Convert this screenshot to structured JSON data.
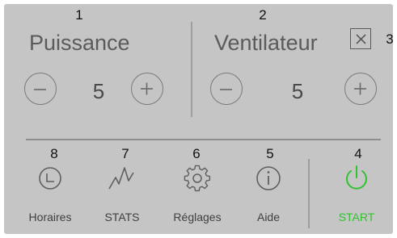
{
  "callouts": {
    "c1": "1",
    "c2": "2",
    "c3": "3",
    "c4": "4",
    "c5": "5",
    "c6": "6",
    "c7": "7",
    "c8": "8"
  },
  "puissance": {
    "title": "Puissance",
    "value": "5"
  },
  "ventilateur": {
    "title": "Ventilateur",
    "value": "5"
  },
  "nav": {
    "horaires": "Horaires",
    "stats": "STATS",
    "reglages": "Réglages",
    "aide": "Aide",
    "start": "START"
  },
  "colors": {
    "panel": "#c6c5c6",
    "text": "#5b5b5b",
    "start_accent": "#2fc22f"
  },
  "icons": {
    "close": "close-icon",
    "minus": "minus-icon",
    "plus": "plus-icon",
    "clock": "clock-icon",
    "stats": "zigzag-stats-icon",
    "settings": "gear-icon",
    "info": "info-icon",
    "power": "power-icon"
  }
}
